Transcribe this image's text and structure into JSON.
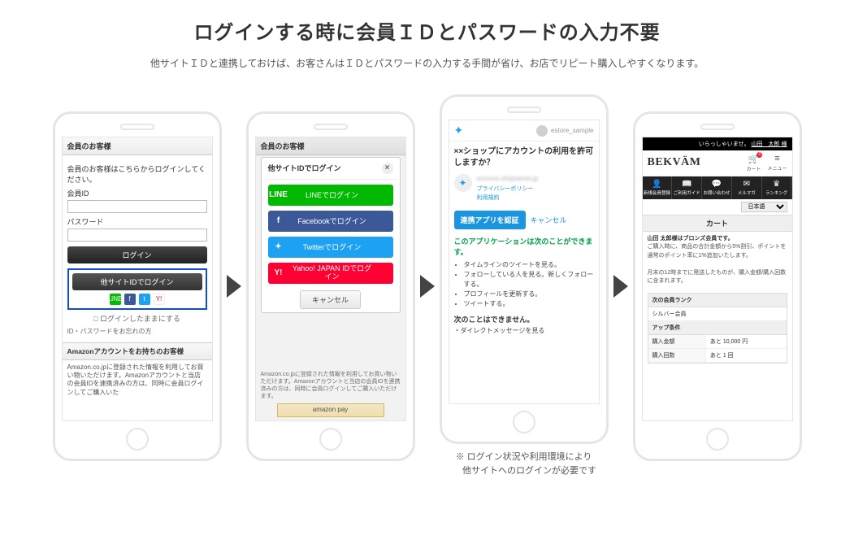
{
  "header": {
    "title": "ログインする時に会員ＩＤとパスワードの入力不要",
    "subtitle": "他サイトＩＤと連携しておけば、お客さんはＩＤとパスワードの入力する手間が省け、お店でリピート購入しやすくなります。"
  },
  "caption": "※ ログイン状況や利用環境により\n　 他サイトへのログインが必要です",
  "screen1": {
    "bar": "会員のお客様",
    "prompt": "会員のお客様はこちらからログインしてください。",
    "id_label": "会員ID",
    "pw_label": "パスワード",
    "login_btn": "ログイン",
    "sso_btn": "他サイトIDでログイン",
    "keep": "□ ログインしたままにする",
    "forgot": "ID・パスワードをお忘れの方",
    "amazon_hdr": "Amazonアカウントをお持ちのお客様",
    "amazon_txt": "Amazon.co.jpに登録された情報を利用してお買い物いただけます。Amazonアカウントと当店の会員IDを連携済みの方は、同時に会員ログインしてご購入いた",
    "icons": {
      "line": "LINE",
      "fb": "f",
      "tw": "t",
      "yh": "Y!"
    }
  },
  "screen2": {
    "bar": "会員のお客様",
    "modal_title": "他サイトIDでログイン",
    "line": "LINEでログイン",
    "fb": "Facebookでログイン",
    "tw": "Twitterでログイン",
    "yh": "Yahoo! JAPAN IDでログイン",
    "cancel": "キャンセル",
    "under": "Amazon.co.jpに登録された情報を利用してお買い物いただけます。Amazonアカウントと当店の会員IDを連携済みの方は、同時に会員ログインしてご購入いただけます。",
    "apay": "amazon pay"
  },
  "screen3": {
    "account": "estore_sample",
    "question_prefix": "××ショップに",
    "question_bold": "アカウントの利用を許可しますか？",
    "app_url": "xxxxxxx.shopserve.jp",
    "privacy": "プライバシーポリシー",
    "terms": "利用規約",
    "auth_btn": "連携アプリを認証",
    "cancel": "キャンセル",
    "perm_hdr": "このアプリケーションは次のことができます。",
    "perms": [
      "タイムラインのツイートを見る。",
      "フォローしている人を見る。新しくフォローする。",
      "プロフィールを更新する。",
      "ツイートする。"
    ],
    "neg_hdr": "次のことはできません。",
    "neg": "・ダイレクトメッセージを見る"
  },
  "screen4": {
    "welcome_prefix": "いらっしゃいませ。",
    "welcome_name": "山田　太郎 様",
    "logo": "BEKVÄM",
    "cart_label": "カート",
    "menu_label": "メニュー",
    "cart_badge": "0",
    "nav": [
      "新規会員登録",
      "ご利用ガイド",
      "お問い合わせ",
      "メルマガ",
      "ランキング"
    ],
    "lang": "日本語",
    "cart_title": "カート",
    "msg_member": "山田 太郎様はブロンズ会員です。",
    "msg_discount": "ご購入時に、商品の合計金額から5%割引、ポイントを通常のポイント率に1%追加いたします。",
    "msg_ship": "月末の12時までに発送したものが、購入金額/購入回数に含まれます。",
    "rank_hdr": "次の会員ランク",
    "rank_val": "シルバー会員",
    "cond_hdr": "アップ条件",
    "amount_k": "購入金額",
    "amount_v": "あと 10,000 円",
    "count_k": "購入回数",
    "count_v": "あと 1 回"
  }
}
